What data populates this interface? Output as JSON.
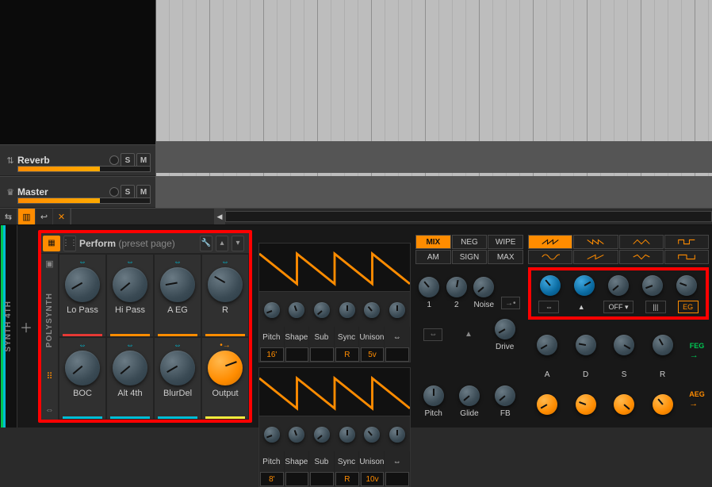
{
  "tracks": {
    "reverb": {
      "name": "Reverb",
      "s": "S",
      "m": "M"
    },
    "master": {
      "name": "Master",
      "s": "S",
      "m": "M"
    }
  },
  "device_rail_label": "SYNTH 4TH",
  "macro": {
    "header": {
      "title": "Perform",
      "subtitle": "(preset page)"
    },
    "side_label": "POLYSYNTH",
    "cells": [
      {
        "label": "Lo Pass",
        "color": "#e53935",
        "rot": -120
      },
      {
        "label": "Hi Pass",
        "color": "#ff8c00",
        "rot": -130
      },
      {
        "label": "A EG",
        "color": "#ff8c00",
        "rot": -100
      },
      {
        "label": "R",
        "color": "#ff8c00",
        "rot": -60
      },
      {
        "label": "BOC",
        "color": "#00bcd4",
        "rot": -130
      },
      {
        "label": "Alt 4th",
        "color": "#00bcd4",
        "rot": -130
      },
      {
        "label": "BlurDel",
        "color": "#00bcd4",
        "rot": -120
      },
      {
        "label": "Output",
        "color": "#ffeb3b",
        "rot": 70,
        "orange": true
      }
    ]
  },
  "osc": {
    "labels": [
      "Pitch",
      "Shape",
      "Sub",
      "Sync",
      "Unison",
      ""
    ],
    "osc1_vals": [
      "16'",
      "",
      "",
      "R",
      "5v",
      ""
    ],
    "osc2_vals": [
      "8'",
      "",
      "",
      "R",
      "10v",
      ""
    ],
    "link_icon": "⇔"
  },
  "mixer": {
    "modes": [
      {
        "l": "MIX",
        "a": true
      },
      {
        "l": "NEG"
      },
      {
        "l": "WIPE"
      },
      {
        "l": "AM"
      },
      {
        "l": "SIGN"
      },
      {
        "l": "MAX"
      }
    ],
    "top_labels": [
      "1",
      "2",
      "Noise"
    ],
    "route_icon": "→•",
    "bottom_labels": [
      "Pitch",
      "Glide",
      "FB"
    ],
    "drive_label": "Drive"
  },
  "env": {
    "shapes": [
      "saw",
      "saw2",
      "tri",
      "pulse",
      "sine",
      "saw3",
      "tri2",
      "square"
    ],
    "ctrl": {
      "link": "⇔",
      "peak": "▲",
      "off": "OFF ▾",
      "bars": "|||",
      "eg": "EG"
    },
    "adsr": [
      "A",
      "D",
      "S",
      "R"
    ],
    "feg": "FEG",
    "aeg": "AEG",
    "arrow": "→"
  }
}
